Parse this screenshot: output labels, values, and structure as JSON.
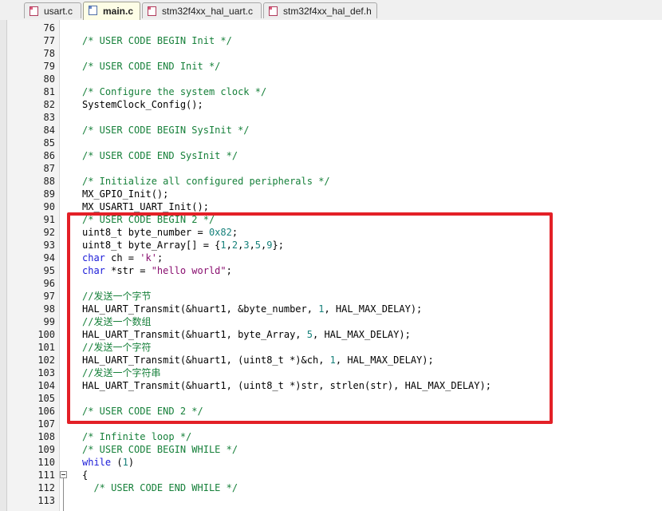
{
  "tabs": [
    {
      "label": "usart.c",
      "active": false
    },
    {
      "label": "main.c",
      "active": true
    },
    {
      "label": "stm32f4xx_hal_uart.c",
      "active": false
    },
    {
      "label": "stm32f4xx_hal_def.h",
      "active": false
    }
  ],
  "editor": {
    "lines": [
      {
        "num": "76",
        "tokens": []
      },
      {
        "num": "77",
        "tokens": [
          {
            "t": "/* USER CODE BEGIN Init */",
            "c": "comment"
          }
        ]
      },
      {
        "num": "78",
        "tokens": []
      },
      {
        "num": "79",
        "tokens": [
          {
            "t": "/* USER CODE END Init */",
            "c": "comment"
          }
        ]
      },
      {
        "num": "80",
        "tokens": []
      },
      {
        "num": "81",
        "tokens": [
          {
            "t": "/* Configure the system clock */",
            "c": "comment"
          }
        ]
      },
      {
        "num": "82",
        "tokens": [
          {
            "t": "SystemClock_Config();",
            "c": "plain"
          }
        ]
      },
      {
        "num": "83",
        "tokens": []
      },
      {
        "num": "84",
        "tokens": [
          {
            "t": "/* USER CODE BEGIN SysInit */",
            "c": "comment"
          }
        ]
      },
      {
        "num": "85",
        "tokens": []
      },
      {
        "num": "86",
        "tokens": [
          {
            "t": "/* USER CODE END SysInit */",
            "c": "comment"
          }
        ]
      },
      {
        "num": "87",
        "tokens": []
      },
      {
        "num": "88",
        "tokens": [
          {
            "t": "/* Initialize all configured peripherals */",
            "c": "comment"
          }
        ]
      },
      {
        "num": "89",
        "tokens": [
          {
            "t": "MX_GPIO_Init();",
            "c": "plain"
          }
        ]
      },
      {
        "num": "90",
        "tokens": [
          {
            "t": "MX_USART1_UART_Init();",
            "c": "plain"
          }
        ]
      },
      {
        "num": "91",
        "tokens": [
          {
            "t": "/* USER CODE BEGIN 2 */",
            "c": "comment"
          }
        ]
      },
      {
        "num": "92",
        "tokens": [
          {
            "t": "uint8_t byte_number = ",
            "c": "plain"
          },
          {
            "t": "0x82",
            "c": "num"
          },
          {
            "t": ";",
            "c": "plain"
          }
        ]
      },
      {
        "num": "93",
        "tokens": [
          {
            "t": "uint8_t byte_Array[] = {",
            "c": "plain"
          },
          {
            "t": "1",
            "c": "num"
          },
          {
            "t": ",",
            "c": "plain"
          },
          {
            "t": "2",
            "c": "num"
          },
          {
            "t": ",",
            "c": "plain"
          },
          {
            "t": "3",
            "c": "num"
          },
          {
            "t": ",",
            "c": "plain"
          },
          {
            "t": "5",
            "c": "num"
          },
          {
            "t": ",",
            "c": "plain"
          },
          {
            "t": "9",
            "c": "num"
          },
          {
            "t": "};",
            "c": "plain"
          }
        ]
      },
      {
        "num": "94",
        "tokens": [
          {
            "t": "char",
            "c": "kw"
          },
          {
            "t": " ch = ",
            "c": "plain"
          },
          {
            "t": "'k'",
            "c": "str"
          },
          {
            "t": ";",
            "c": "plain"
          }
        ]
      },
      {
        "num": "95",
        "tokens": [
          {
            "t": "char",
            "c": "kw"
          },
          {
            "t": " *str = ",
            "c": "plain"
          },
          {
            "t": "\"hello world\"",
            "c": "str"
          },
          {
            "t": ";",
            "c": "plain"
          }
        ]
      },
      {
        "num": "96",
        "tokens": []
      },
      {
        "num": "97",
        "tokens": [
          {
            "t": "//发送一个字节",
            "c": "comment"
          }
        ]
      },
      {
        "num": "98",
        "tokens": [
          {
            "t": "HAL_UART_Transmit(&huart1, &byte_number, ",
            "c": "plain"
          },
          {
            "t": "1",
            "c": "num"
          },
          {
            "t": ", HAL_MAX_DELAY);",
            "c": "plain"
          }
        ]
      },
      {
        "num": "99",
        "tokens": [
          {
            "t": "//发送一个数组",
            "c": "comment"
          }
        ]
      },
      {
        "num": "100",
        "tokens": [
          {
            "t": "HAL_UART_Transmit(&huart1, byte_Array, ",
            "c": "plain"
          },
          {
            "t": "5",
            "c": "num"
          },
          {
            "t": ", HAL_MAX_DELAY);",
            "c": "plain"
          }
        ]
      },
      {
        "num": "101",
        "tokens": [
          {
            "t": "//发送一个字符",
            "c": "comment"
          }
        ]
      },
      {
        "num": "102",
        "tokens": [
          {
            "t": "HAL_UART_Transmit(&huart1, (uint8_t *)&ch, ",
            "c": "plain"
          },
          {
            "t": "1",
            "c": "num"
          },
          {
            "t": ", HAL_MAX_DELAY);",
            "c": "plain"
          }
        ]
      },
      {
        "num": "103",
        "tokens": [
          {
            "t": "//发送一个字符串",
            "c": "comment"
          }
        ]
      },
      {
        "num": "104",
        "tokens": [
          {
            "t": "HAL_UART_Transmit(&huart1, (uint8_t *)str, strlen(str), HAL_MAX_DELAY);",
            "c": "plain"
          }
        ]
      },
      {
        "num": "105",
        "tokens": []
      },
      {
        "num": "106",
        "tokens": [
          {
            "t": "/* USER CODE END 2 */",
            "c": "comment"
          }
        ]
      },
      {
        "num": "107",
        "tokens": []
      },
      {
        "num": "108",
        "tokens": [
          {
            "t": "/* Infinite loop */",
            "c": "comment"
          }
        ]
      },
      {
        "num": "109",
        "tokens": [
          {
            "t": "/* USER CODE BEGIN WHILE */",
            "c": "comment"
          }
        ]
      },
      {
        "num": "110",
        "tokens": [
          {
            "t": "while",
            "c": "kw"
          },
          {
            "t": " (",
            "c": "plain"
          },
          {
            "t": "1",
            "c": "num"
          },
          {
            "t": ")",
            "c": "plain"
          }
        ]
      },
      {
        "num": "111",
        "tokens": [
          {
            "t": "{",
            "c": "plain"
          }
        ],
        "fold": true
      },
      {
        "num": "112",
        "tokens": [
          {
            "t": "  /* USER CODE END WHILE */",
            "c": "comment"
          }
        ]
      },
      {
        "num": "113",
        "tokens": []
      }
    ]
  },
  "colors": {
    "comment": "#16803a",
    "keyword": "#1a1ad8",
    "number": "#16807a",
    "string": "#8a1070",
    "highlight_border": "#e32027"
  }
}
